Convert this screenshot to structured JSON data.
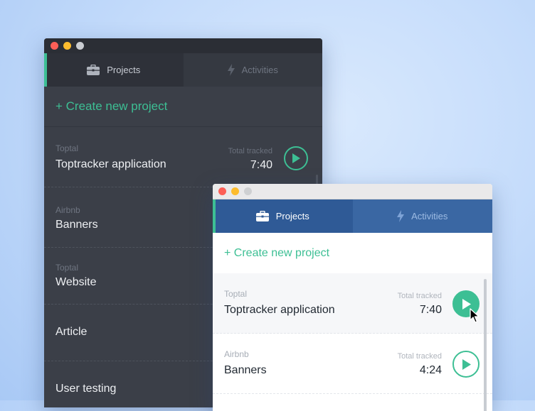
{
  "dark_window": {
    "tabs": [
      {
        "label": "Projects",
        "icon": "briefcase-icon",
        "active": true
      },
      {
        "label": "Activities",
        "icon": "bolt-icon",
        "active": false
      }
    ],
    "create_label": "+ Create new project",
    "projects": [
      {
        "client": "Toptal",
        "name": "Toptracker application",
        "tracked_label": "Total tracked",
        "tracked": "7:40"
      },
      {
        "client": "Airbnb",
        "name": "Banners"
      },
      {
        "client": "Toptal",
        "name": "Website"
      },
      {
        "client": "",
        "name": "Article"
      },
      {
        "client": "",
        "name": "User testing"
      }
    ]
  },
  "light_window": {
    "tabs": [
      {
        "label": "Projects",
        "icon": "briefcase-icon",
        "active": true
      },
      {
        "label": "Activities",
        "icon": "bolt-icon",
        "active": false
      }
    ],
    "create_label": "+ Create new project",
    "projects": [
      {
        "client": "Toptal",
        "name": "Toptracker application",
        "tracked_label": "Total tracked",
        "tracked": "7:40"
      },
      {
        "client": "Airbnb",
        "name": "Banners",
        "tracked_label": "Total tracked",
        "tracked": "4:24"
      }
    ]
  },
  "colors": {
    "accent": "#3dbf94",
    "dark_bg": "#3b3f48",
    "light_tab_bar": "#3a67a3"
  }
}
